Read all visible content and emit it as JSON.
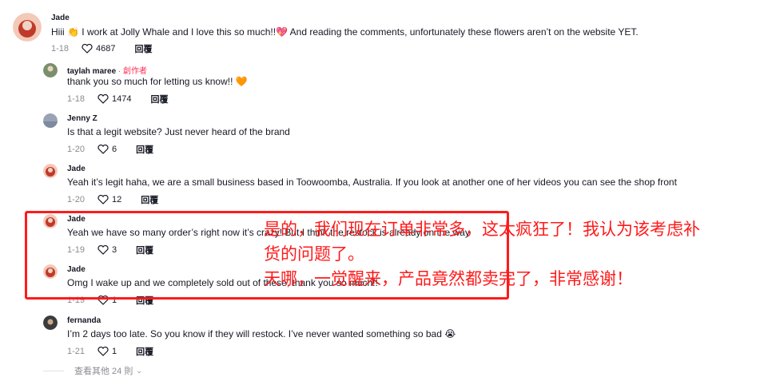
{
  "comments": [
    {
      "name": "Jade",
      "creator": "",
      "text": "Hiii 👏 I work at Jolly Whale and I love this so much!!💖 And reading the comments, unfortunately these flowers aren’t on the website YET.",
      "date": "1-18",
      "likes": "4687",
      "reply": "回覆",
      "avatar_color": "#c0392b"
    },
    {
      "name": "taylah maree",
      "creator": " · 創作者",
      "text": "thank you so much for letting us know!! 🧡",
      "date": "1-18",
      "likes": "1474",
      "reply": "回覆",
      "avatar_color": "#7a8f6a"
    },
    {
      "name": "Jenny Z",
      "creator": "",
      "text": "Is that a legit website? Just never heard of the brand",
      "date": "1-20",
      "likes": "6",
      "reply": "回覆",
      "avatar_color": "#9aa3b5"
    },
    {
      "name": "Jade",
      "creator": "",
      "text": "Yeah it’s legit haha, we are a small business based in Toowoomba, Australia. If you look at another one of her videos you can see the shop front",
      "date": "1-20",
      "likes": "12",
      "reply": "回覆",
      "avatar_color": "#c0392b"
    },
    {
      "name": "Jade",
      "creator": "",
      "text": "Yeah we have so many order’s right now it’s crazy! But I think the restock is already on the way",
      "date": "1-19",
      "likes": "3",
      "reply": "回覆",
      "avatar_color": "#c0392b"
    },
    {
      "name": "Jade",
      "creator": "",
      "text": "Omg I wake up and we completely sold out of these, thank you so much!!",
      "date": "1-19",
      "likes": "1",
      "reply": "回覆",
      "avatar_color": "#c0392b"
    },
    {
      "name": "fernanda",
      "creator": "",
      "text": "I’m 2 days too late. So you know if they will restock. I’ve never wanted something so bad 😭",
      "date": "1-21",
      "likes": "1",
      "reply": "回覆",
      "avatar_color": "#3b3b3b"
    }
  ],
  "view_more": "查看其他 24 則",
  "overlay": {
    "line1": "是的，我们现在订单非常多，这太疯狂了！我认为该考虑补",
    "line2": "货的问题了。",
    "line3": "天哪，一觉醒来，产品竟然都卖完了，非常感谢！"
  },
  "colors": {
    "accent_red": "#ff1a1a",
    "creator_red": "#fe2c55",
    "meta_gray": "#8a8b91"
  }
}
